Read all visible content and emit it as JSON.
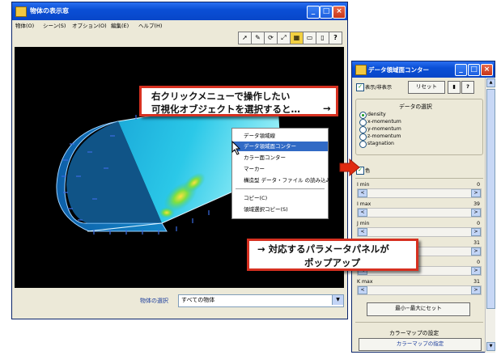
{
  "main_window": {
    "title": "物体の表示窓",
    "menu": [
      "物体(O)",
      "シーン(S)",
      "オプション(O)",
      "編集(E)",
      "ヘルプ(H)"
    ],
    "toolbar_icons": [
      "cursor-icon",
      "pencil-icon",
      "rotate-icon",
      "zoom-icon",
      "color-icon",
      "window-icon",
      "save-icon",
      "help-icon"
    ],
    "help_label": "?",
    "object_select_label": "物体の選択",
    "object_select_value": "すべての物体"
  },
  "context_menu": {
    "items": [
      "データ領域線",
      "データ領域面コンター",
      "カラー面コンター",
      "マーカー",
      "構造型 データ・ファイル の読み込み",
      "コピー(C)",
      "領域選択コピー(S)"
    ],
    "highlighted_index": 1
  },
  "callouts": {
    "first_line1": "右クリックメニューで操作したい",
    "first_line2": "可視化オブジェクトを選択すると…",
    "first_arrow": "→",
    "second_line1": "→ 対応するパラメータパネルが",
    "second_line2": "ポップアップ"
  },
  "panel": {
    "title": "データ領域面コンター",
    "show_hide_label": "表示/非表示",
    "reset_label": "リセット",
    "help_label": "?",
    "data_select_label": "データの選択",
    "data_options": [
      "density",
      "x-momentum",
      "y-momentum",
      "z-momentum",
      "stagnation"
    ],
    "selected_option_index": 0,
    "color_label": "色",
    "sliders": [
      {
        "label": "I min",
        "value": "0"
      },
      {
        "label": "I max",
        "value": "39"
      },
      {
        "label": "J min",
        "value": "0"
      },
      {
        "label": "",
        "value": "31"
      },
      {
        "label": "",
        "value": "0"
      },
      {
        "label": "K max",
        "value": "31"
      }
    ],
    "minmax_reset_label": "最小−最大にセット",
    "colormap_settings_label": "カラーマップの設定",
    "colormap_button_label": "カラーマップの指定"
  },
  "colors": {
    "titlebar": "#0a4fd6",
    "callout_border": "#d63020",
    "highlight": "#316ac5",
    "accent_blue": "#1a3c9c"
  }
}
